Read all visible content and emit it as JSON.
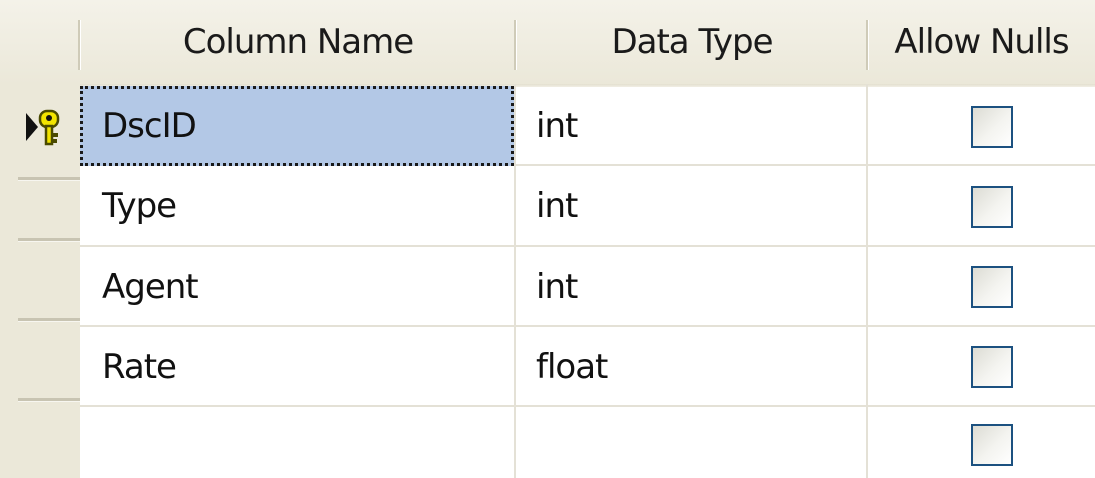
{
  "headers": {
    "column_name": "Column Name",
    "data_type": "Data Type",
    "allow_nulls": "Allow Nulls"
  },
  "rows": [
    {
      "name": "DscID",
      "type": "int",
      "allow_nulls": false,
      "primary_key": true,
      "current": true
    },
    {
      "name": "Type",
      "type": "int",
      "allow_nulls": false
    },
    {
      "name": "Agent",
      "type": "int",
      "allow_nulls": false
    },
    {
      "name": "Rate",
      "type": "float",
      "allow_nulls": false
    },
    {
      "name": "",
      "type": "",
      "allow_nulls": false
    }
  ],
  "colors": {
    "selection": "#b3c8e6",
    "header_bg": "#ebe8d9",
    "checkbox_border": "#1c5180",
    "key_icon": "#f2e400"
  },
  "icons": {
    "current_row": "triangle-arrow-icon",
    "primary_key": "key-icon"
  }
}
